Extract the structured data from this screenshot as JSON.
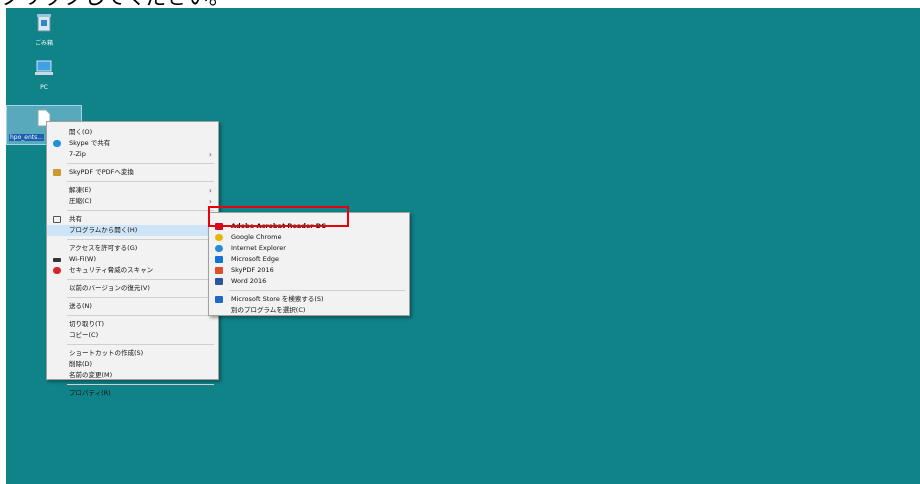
{
  "caption": "クリックしてください。",
  "desktop": {
    "background": "#0f8388",
    "icons": [
      {
        "label": "ごみ箱",
        "icon": "recycle-bin-icon"
      },
      {
        "label": "PC",
        "icon": "pc-icon"
      },
      {
        "label": "hpo_ents...",
        "icon": "file-icon"
      }
    ]
  },
  "context_menu": {
    "items": [
      "開く(O)",
      "Skype で共有",
      "7-Zip",
      "SkyPDF でPDFへ変換",
      "解凍(E)",
      "圧縮(C)",
      "共有",
      "プログラムから開く(H)",
      "アクセスを許可する(G)",
      "Wi-Fi(W)",
      "セキュリティ脅威のスキャン",
      "以前のバージョンの復元(V)",
      "送る(N)",
      "切り取り(T)",
      "コピー(C)",
      "ショートカットの作成(S)",
      "削除(D)",
      "名前の変更(M)",
      "プロパティ(R)"
    ]
  },
  "submenu": {
    "items": [
      "Adobe Acrobat Reader DC",
      "Google Chrome",
      "Internet Explorer",
      "Microsoft Edge",
      "SkyPDF 2016",
      "Word 2016",
      "Microsoft Store を検索する(S)",
      "別のプログラムを選択(C)"
    ]
  },
  "colors": {
    "highlight_border": "#e8000b",
    "menu_background": "#f2f2f2",
    "hover": "#cde5f7"
  }
}
